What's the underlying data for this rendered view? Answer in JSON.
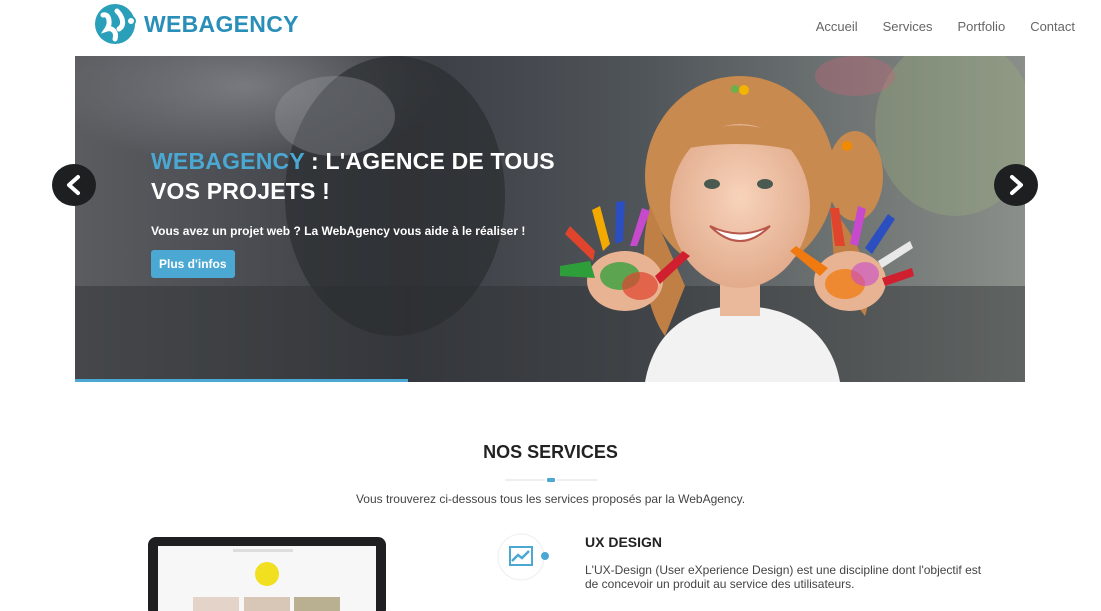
{
  "header": {
    "logo_text": "WEBAGENCY",
    "nav": [
      "Accueil",
      "Services",
      "Portfolio",
      "Contact"
    ]
  },
  "hero": {
    "title_accent": "WEBAGENCY",
    "title_rest": " : L'AGENCE DE TOUS VOS PROJETS !",
    "subtitle": "Vous avez un projet web ? La WebAgency vous aide à le réaliser !",
    "button_label": "Plus d'infos",
    "progress_fraction": 0.35
  },
  "services": {
    "title": "NOS SERVICES",
    "intro": "Vous trouverez ci-dessous tous les services proposés par la WebAgency.",
    "items": [
      {
        "title": "UX DESIGN",
        "description": "L'UX-Design (User eXperience Design) est une discipline dont l'objectif est de concevoir un produit au service des utilisateurs.",
        "icon": "trending-chart-icon"
      }
    ]
  },
  "colors": {
    "accent": "#4aa8d3",
    "logo": "#2a8fb8",
    "nav_text": "#666666",
    "slider_bg": "#3a3d42"
  }
}
